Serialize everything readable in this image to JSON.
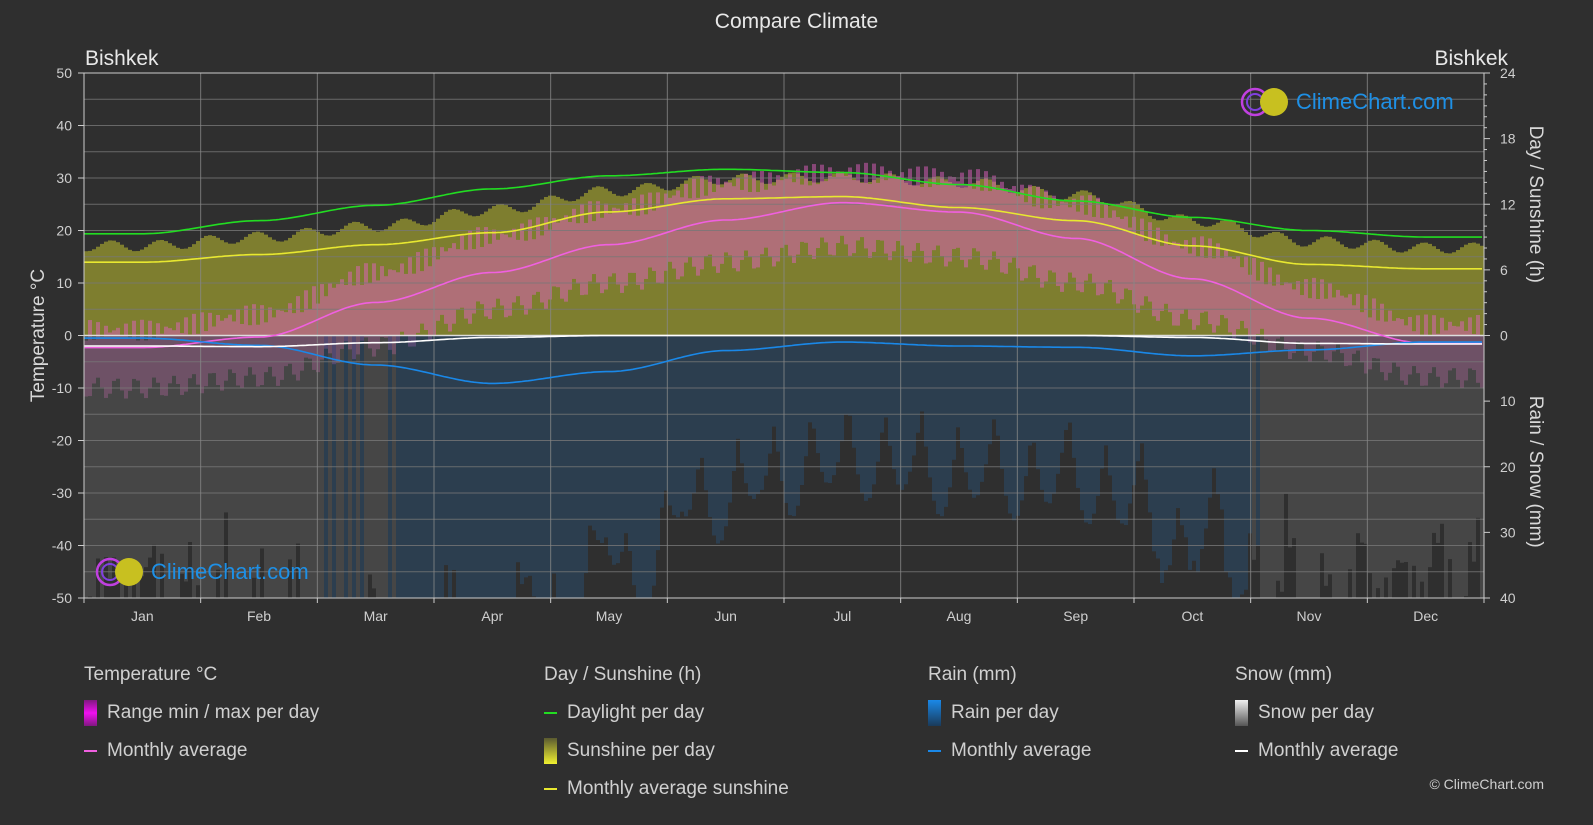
{
  "header": {
    "title": "Compare Climate",
    "city_left": "Bishkek",
    "city_right": "Bishkek"
  },
  "logo": {
    "text": "ClimeChart.com"
  },
  "copyright": "© ClimeChart.com",
  "legend": {
    "groups": [
      {
        "title": "Temperature °C",
        "items": [
          {
            "label": "Range min / max per day",
            "kind": "bar",
            "color": "#e020e0"
          },
          {
            "label": "Monthly average",
            "kind": "line",
            "color": "#f060e0"
          }
        ]
      },
      {
        "title": "Day / Sunshine (h)",
        "items": [
          {
            "label": "Daylight per day",
            "kind": "line",
            "color": "#22dd22"
          },
          {
            "label": "Sunshine per day",
            "kind": "bar",
            "color": "#e8e830"
          },
          {
            "label": "Monthly average sunshine",
            "kind": "line",
            "color": "#e8e830"
          }
        ]
      },
      {
        "title": "Rain (mm)",
        "items": [
          {
            "label": "Rain per day",
            "kind": "bar",
            "color": "#1a88e8"
          },
          {
            "label": "Monthly average",
            "kind": "line",
            "color": "#1a88e8"
          }
        ]
      },
      {
        "title": "Snow (mm)",
        "items": [
          {
            "label": "Snow per day",
            "kind": "bar",
            "color": "#e0e0e0"
          },
          {
            "label": "Monthly average",
            "kind": "line",
            "color": "#ffffff"
          }
        ]
      }
    ]
  },
  "chart_data": {
    "type": "line",
    "title": "Compare Climate",
    "categories": [
      "Jan",
      "Feb",
      "Mar",
      "Apr",
      "May",
      "Jun",
      "Jul",
      "Aug",
      "Sep",
      "Oct",
      "Nov",
      "Dec"
    ],
    "axes": {
      "left": {
        "label": "Temperature °C",
        "range": [
          -50,
          50
        ],
        "ticks": [
          50,
          40,
          30,
          20,
          10,
          0,
          -10,
          -20,
          -30,
          -40,
          -50
        ]
      },
      "right_top": {
        "label": "Day / Sunshine (h)",
        "range": [
          0,
          24
        ],
        "ticks": [
          24,
          18,
          12,
          6,
          0
        ]
      },
      "right_bottom": {
        "label": "Rain / Snow (mm)",
        "range": [
          0,
          40
        ],
        "ticks": [
          0,
          10,
          20,
          30,
          40
        ]
      }
    },
    "grid": true,
    "series": [
      {
        "name": "Temperature monthly average",
        "axis": "left",
        "color": "#f060e0",
        "values": [
          -2.3,
          -0.3,
          6.3,
          12.0,
          17.3,
          22.0,
          25.3,
          23.5,
          18.5,
          10.8,
          3.3,
          -1.5
        ]
      },
      {
        "name": "Daylight per day",
        "axis": "right_top",
        "color": "#22dd22",
        "values": [
          9.3,
          10.5,
          11.9,
          13.4,
          14.6,
          15.2,
          14.9,
          13.8,
          12.3,
          10.8,
          9.6,
          9.0
        ]
      },
      {
        "name": "Monthly average sunshine",
        "axis": "right_top",
        "color": "#e8e830",
        "values": [
          6.7,
          7.4,
          8.3,
          9.4,
          11.3,
          12.5,
          12.7,
          11.7,
          10.5,
          8.2,
          6.5,
          6.1
        ]
      },
      {
        "name": "Rain monthly average",
        "axis": "right_bottom",
        "color": "#1a88e8",
        "values": [
          0.4,
          1.5,
          4.5,
          7.3,
          5.5,
          2.3,
          1.0,
          1.6,
          1.8,
          3.1,
          2.2,
          1.0
        ]
      },
      {
        "name": "Snow monthly average",
        "axis": "right_bottom",
        "color": "#ffffff",
        "values": [
          1.6,
          1.7,
          1.1,
          0.3,
          0.0,
          0.0,
          0.0,
          0.0,
          0.0,
          0.3,
          1.2,
          1.3
        ]
      }
    ],
    "ranges": {
      "temp_daily_max_approx": [
        1,
        4,
        12,
        19,
        24,
        29,
        31,
        30,
        25,
        17,
        9,
        2
      ],
      "temp_daily_min_approx": [
        -10,
        -8,
        -2,
        5,
        10,
        14,
        17,
        15,
        10,
        3,
        -3,
        -8
      ],
      "sunshine_daily_approx": [
        8.2,
        9.0,
        10.0,
        11.5,
        13.2,
        14.3,
        14.5,
        14.0,
        12.8,
        10.5,
        8.6,
        8.0
      ]
    }
  }
}
